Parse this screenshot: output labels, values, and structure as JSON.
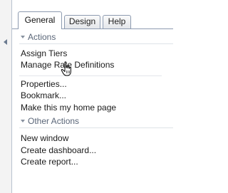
{
  "tabs": [
    {
      "label": "General",
      "active": true
    },
    {
      "label": "Design",
      "active": false
    },
    {
      "label": "Help",
      "active": false
    }
  ],
  "sections": {
    "actions": {
      "title": "Actions",
      "items": [
        "Assign Tiers",
        "Manage Rate Definitions"
      ],
      "items2": [
        "Properties...",
        "Bookmark...",
        "Make this my home page"
      ]
    },
    "other": {
      "title": "Other Actions",
      "items": [
        "New window",
        "Create dashboard...",
        "Create report..."
      ]
    }
  },
  "icons": {
    "collapse": "chevron-left-icon",
    "section_toggle": "triangle-down-icon",
    "cursor": "hand-pointer-icon"
  },
  "colors": {
    "tab_border": "#8d9bb0",
    "section_header": "#5a6678"
  }
}
